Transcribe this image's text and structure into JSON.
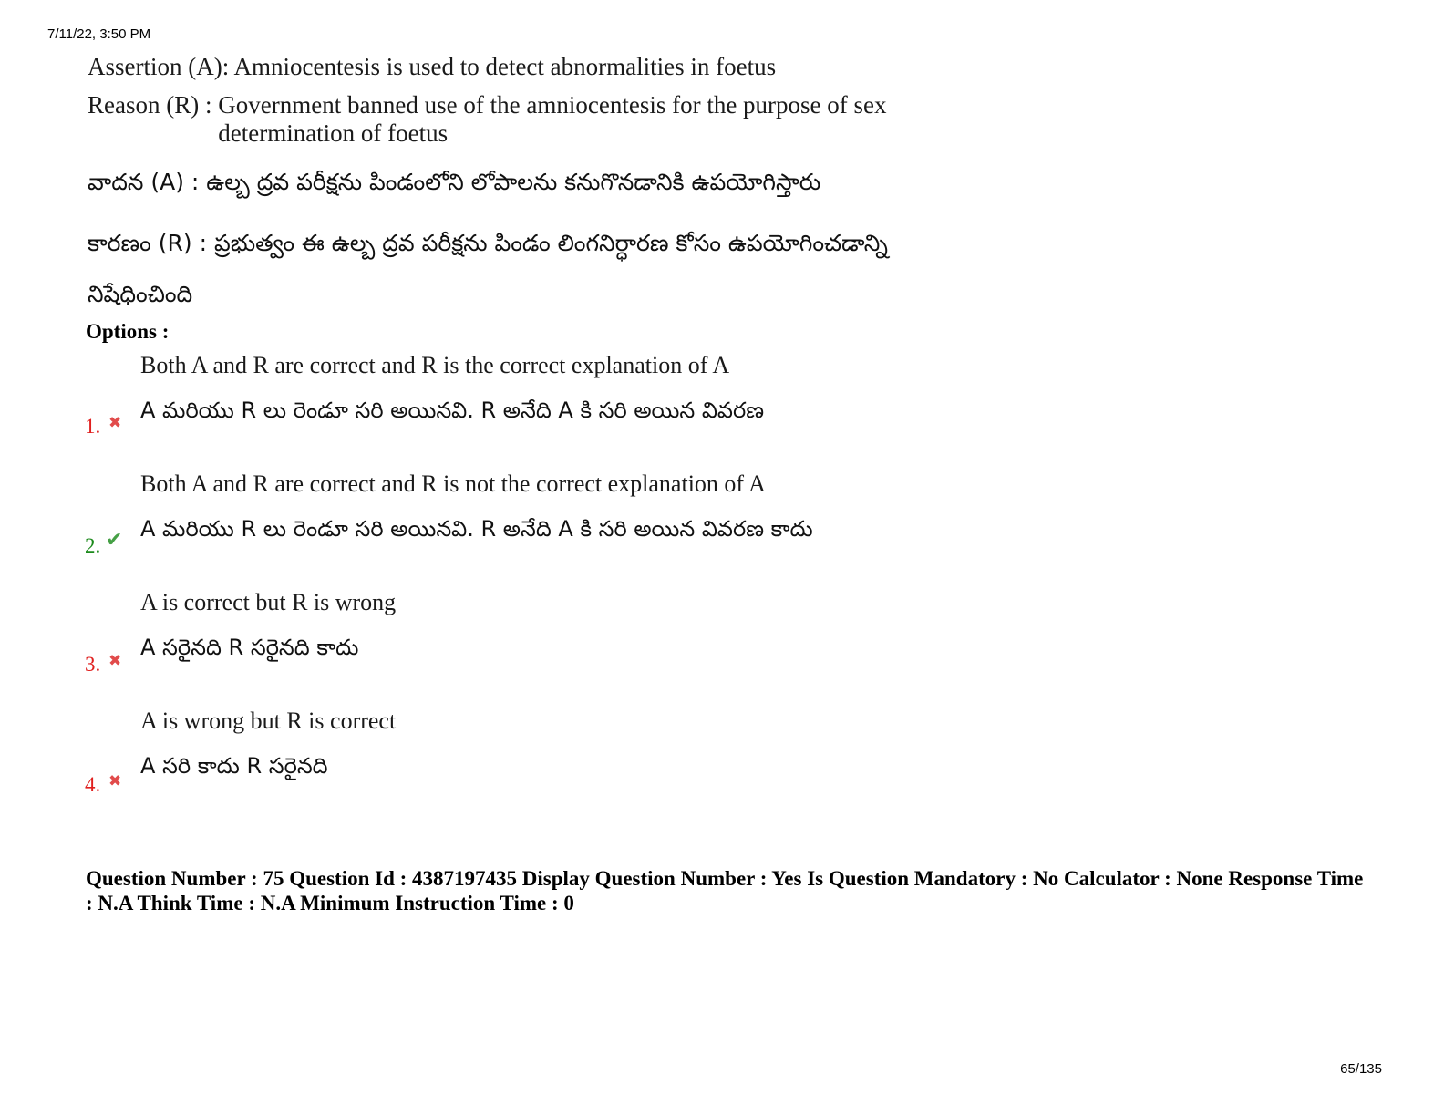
{
  "header": {
    "datetime": "7/11/22, 3:50 PM"
  },
  "question": {
    "assertion_en": "Assertion (A): Amniocentesis is used to detect abnormalities in foetus",
    "reason_label": "Reason (R) :",
    "reason_en_line1": "Government banned use of the amniocentesis for the purpose of sex",
    "reason_en_line2": "determination of foetus",
    "assertion_te": "వాదన (A) : ఉల్బ ద్రవ పరీక్షను పిండంలోని లోపాలను కనుగొనడానికి ఉపయోగిస్తారు",
    "reason_te_line1": "కారణం (R) : ప్రభుత్వం ఈ ఉల్బ ద్రవ పరీక్షను పిండం లింగనిర్ధారణ కోసం ఉపయోగించడాన్ని",
    "reason_te_line2": "నిషేధించింది"
  },
  "options_label": "Options :",
  "options": [
    {
      "number": "1.",
      "status": "wrong",
      "text_en": "Both A and R are correct and R is the correct explanation of A",
      "text_te": "A మరియు R లు రెండూ సరి అయినవి. R అనేది A కి సరి అయిన వివరణ"
    },
    {
      "number": "2.",
      "status": "correct",
      "text_en": "Both A and R are correct and R is not the correct explanation of A",
      "text_te": "A మరియు R లు రెండూ సరి అయినవి. R అనేది A కి సరి అయిన వివరణ  కాదు"
    },
    {
      "number": "3.",
      "status": "wrong",
      "text_en": "A is correct but R is wrong",
      "text_te": "A సరైనది R సరైనది కాదు"
    },
    {
      "number": "4.",
      "status": "wrong",
      "text_en": "A is wrong but R is correct",
      "text_te": "A సరి కాదు R సరైనది"
    }
  ],
  "meta": {
    "text": "Question Number : 75 Question Id : 4387197435 Display Question Number : Yes Is Question Mandatory : No Calculator : None Response Time : N.A Think Time : N.A Minimum Instruction Time : 0"
  },
  "footer": {
    "page": "65/135"
  },
  "icons": {
    "wrong": "cross-icon",
    "correct": "check-icon"
  },
  "colors": {
    "wrong": "#e0201f",
    "correct": "#1c8a1c"
  }
}
